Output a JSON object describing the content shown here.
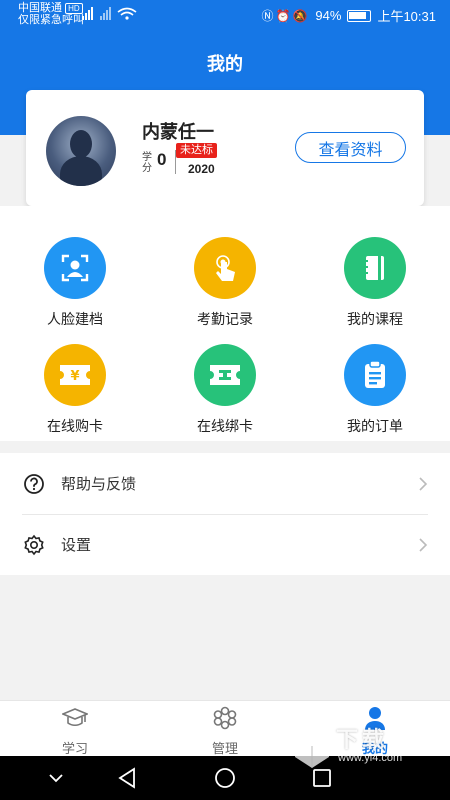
{
  "status_bar": {
    "carrier_line1": "中国联通",
    "hd_label": "HD",
    "carrier_line2": "仅限紧急呼叫",
    "battery": "94%",
    "time": "上午10:31"
  },
  "header": {
    "title": "我的"
  },
  "profile": {
    "name": "内蒙任一",
    "credit_label": "学分",
    "credit_value": "0",
    "status_badge": "未达标",
    "year": "2020",
    "view_button": "查看资料"
  },
  "grid": [
    {
      "label": "人脸建档",
      "icon": "face-scan-icon",
      "color": "#2196f3"
    },
    {
      "label": "考勤记录",
      "icon": "tap-hand-icon",
      "color": "#f5b400"
    },
    {
      "label": "我的课程",
      "icon": "notebook-icon",
      "color": "#27c27a"
    },
    {
      "label": "在线购卡",
      "icon": "yen-ticket-icon",
      "color": "#f5b400"
    },
    {
      "label": "在线绑卡",
      "icon": "card-link-icon",
      "color": "#27c27a"
    },
    {
      "label": "我的订单",
      "icon": "clipboard-icon",
      "color": "#2196f3"
    }
  ],
  "list": [
    {
      "label": "帮助与反馈",
      "icon": "help-circle-icon"
    },
    {
      "label": "设置",
      "icon": "gear-icon"
    }
  ],
  "tabs": [
    {
      "label": "学习",
      "icon": "graduation-cap-icon"
    },
    {
      "label": "管理",
      "icon": "manage-icon"
    },
    {
      "label": "我的",
      "icon": "user-icon",
      "active": true
    }
  ],
  "watermark": {
    "text": "下载",
    "url": "www.yi4.com"
  },
  "colors": {
    "primary": "#1677e6",
    "badge_red": "#e8221b"
  }
}
